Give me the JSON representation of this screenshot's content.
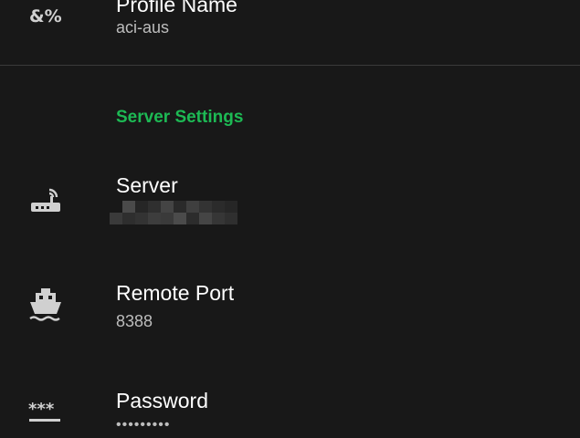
{
  "theme": {
    "accent": "#1db954",
    "background": "#181818",
    "text_primary": "#ffffff",
    "text_secondary": "#bdbdbd"
  },
  "profile_name": {
    "title": "Profile Name",
    "value": "aci-aus",
    "icon": "profile-symbols-icon"
  },
  "server_settings": {
    "header": "Server Settings",
    "items": [
      {
        "title": "Server",
        "value": "",
        "icon": "router-icon"
      },
      {
        "title": "Remote Port",
        "value": "8388",
        "icon": "ship-icon"
      },
      {
        "title": "Password",
        "value": "•••••••••",
        "icon": "password-icon"
      }
    ]
  }
}
